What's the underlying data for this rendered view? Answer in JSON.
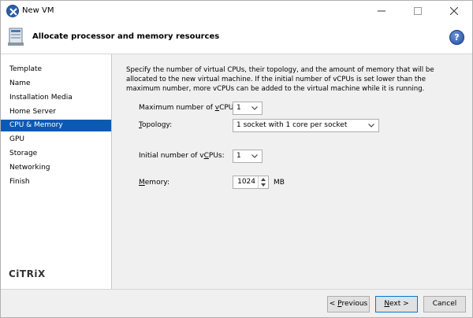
{
  "window": {
    "title": "New VM",
    "app_icon": "xencenter-icon"
  },
  "header": {
    "title": "Allocate processor and memory resources",
    "help_label": "?"
  },
  "sidebar": {
    "items": [
      {
        "label": "Template",
        "active": false
      },
      {
        "label": "Name",
        "active": false
      },
      {
        "label": "Installation Media",
        "active": false
      },
      {
        "label": "Home Server",
        "active": false
      },
      {
        "label": "CPU & Memory",
        "active": true
      },
      {
        "label": "GPU",
        "active": false
      },
      {
        "label": "Storage",
        "active": false
      },
      {
        "label": "Networking",
        "active": false
      },
      {
        "label": "Finish",
        "active": false
      }
    ],
    "brand": "CiTRiX"
  },
  "main": {
    "description": "Specify the number of virtual CPUs, their topology, and the amount of memory that will be allocated to the new virtual machine. If the initial number of vCPUs is set lower than the maximum number, more vCPUs can be added to the virtual machine while it is running.",
    "max_vcpus": {
      "label_pre": "Maximum number of ",
      "label_u": "v",
      "label_post": "CPUs:",
      "value": "1"
    },
    "topology": {
      "label_u": "T",
      "label_post": "opology:",
      "value": "1 socket with 1 core per socket"
    },
    "initial_vcpus": {
      "label_pre": "Initial number of v",
      "label_u": "C",
      "label_post": "PUs:",
      "value": "1"
    },
    "memory": {
      "label_u": "M",
      "label_post": "emory:",
      "value": "1024",
      "unit": "MB"
    }
  },
  "footer": {
    "previous": {
      "pre": "< ",
      "u": "P",
      "post": "revious"
    },
    "next": {
      "u": "N",
      "post": "ext >"
    },
    "cancel": "Cancel"
  },
  "colors": {
    "active_nav": "#0a5ab4",
    "help_icon": "#1d4da3"
  }
}
